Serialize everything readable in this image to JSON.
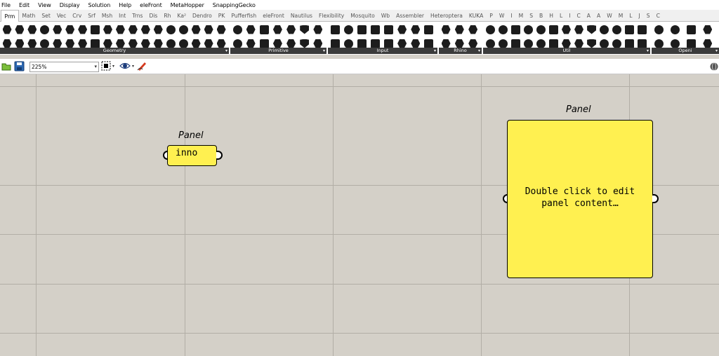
{
  "menu": [
    "File",
    "Edit",
    "View",
    "Display",
    "Solution",
    "Help",
    "eleFront",
    "MetaHopper",
    "SnappingGecko"
  ],
  "tabs": [
    "Prm",
    "Math",
    "Set",
    "Vec",
    "Crv",
    "Srf",
    "Msh",
    "Int",
    "Trns",
    "Dis",
    "Rh",
    "Ka²",
    "Dendro",
    "PK",
    "Pufferfish",
    "eleFront",
    "Nautilus",
    "Flexibility",
    "Mosquito",
    "Wb",
    "Assembler",
    "Heteroptera",
    "KUKA",
    "P",
    "W",
    "I",
    "M",
    "S",
    "B",
    "H",
    "L",
    "I",
    "C",
    "A",
    "A",
    "W",
    "M",
    "L",
    "J",
    "S",
    "C"
  ],
  "active_tab": "Prm",
  "ribbon_groups": [
    "Geometry",
    "Primitive",
    "Input",
    "Rhino",
    "Util",
    "Openi"
  ],
  "zoom": {
    "value": "225%"
  },
  "panels": {
    "small": {
      "title": "Panel",
      "text": "inno"
    },
    "large": {
      "title": "Panel",
      "text": "Double click to edit\npanel content…"
    }
  },
  "colors": {
    "panel_fill": "#fff050",
    "canvas": "#d4d0c8"
  }
}
